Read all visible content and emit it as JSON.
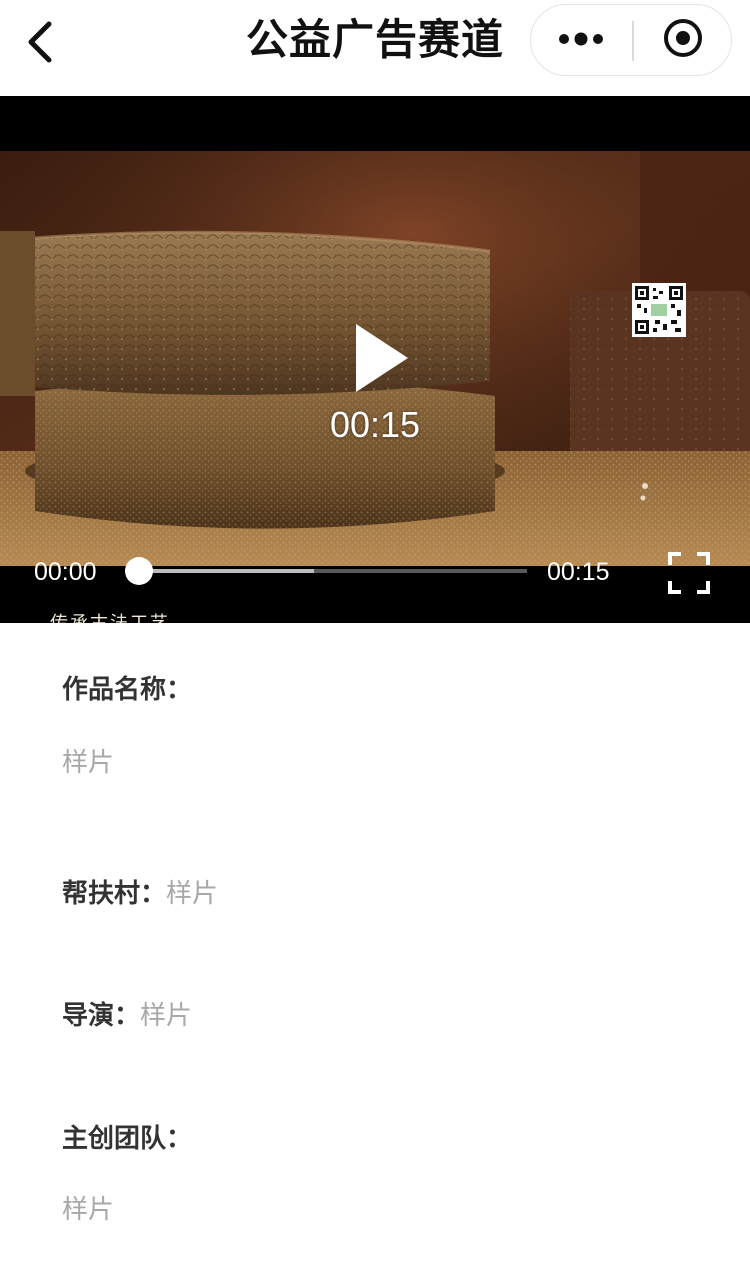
{
  "navbar": {
    "title": "公益广告赛道",
    "back_icon": "chevron-left-icon",
    "more_icon": "more-dots-icon",
    "close_icon": "target-circle-icon"
  },
  "video": {
    "overlay_caption": "传承古法工艺",
    "play_duration": "00:15",
    "current_time": "00:00",
    "total_time": "00:15",
    "progress_fraction": 0.0,
    "buffered_fraction": 0.45,
    "play_icon": "play-icon",
    "fullscreen_icon": "fullscreen-icon",
    "qr_icon": "qr-code-icon"
  },
  "info": {
    "work_name_label": "作品名称：",
    "work_name_value": "样片",
    "village_label": "帮扶村：",
    "village_value": "样片",
    "director_label": "导演：",
    "director_value": "样片",
    "team_label": "主创团队：",
    "team_value": "样片"
  },
  "colors": {
    "label": "#333333",
    "value": "#a8a8a8",
    "video_bg": "#000000"
  }
}
